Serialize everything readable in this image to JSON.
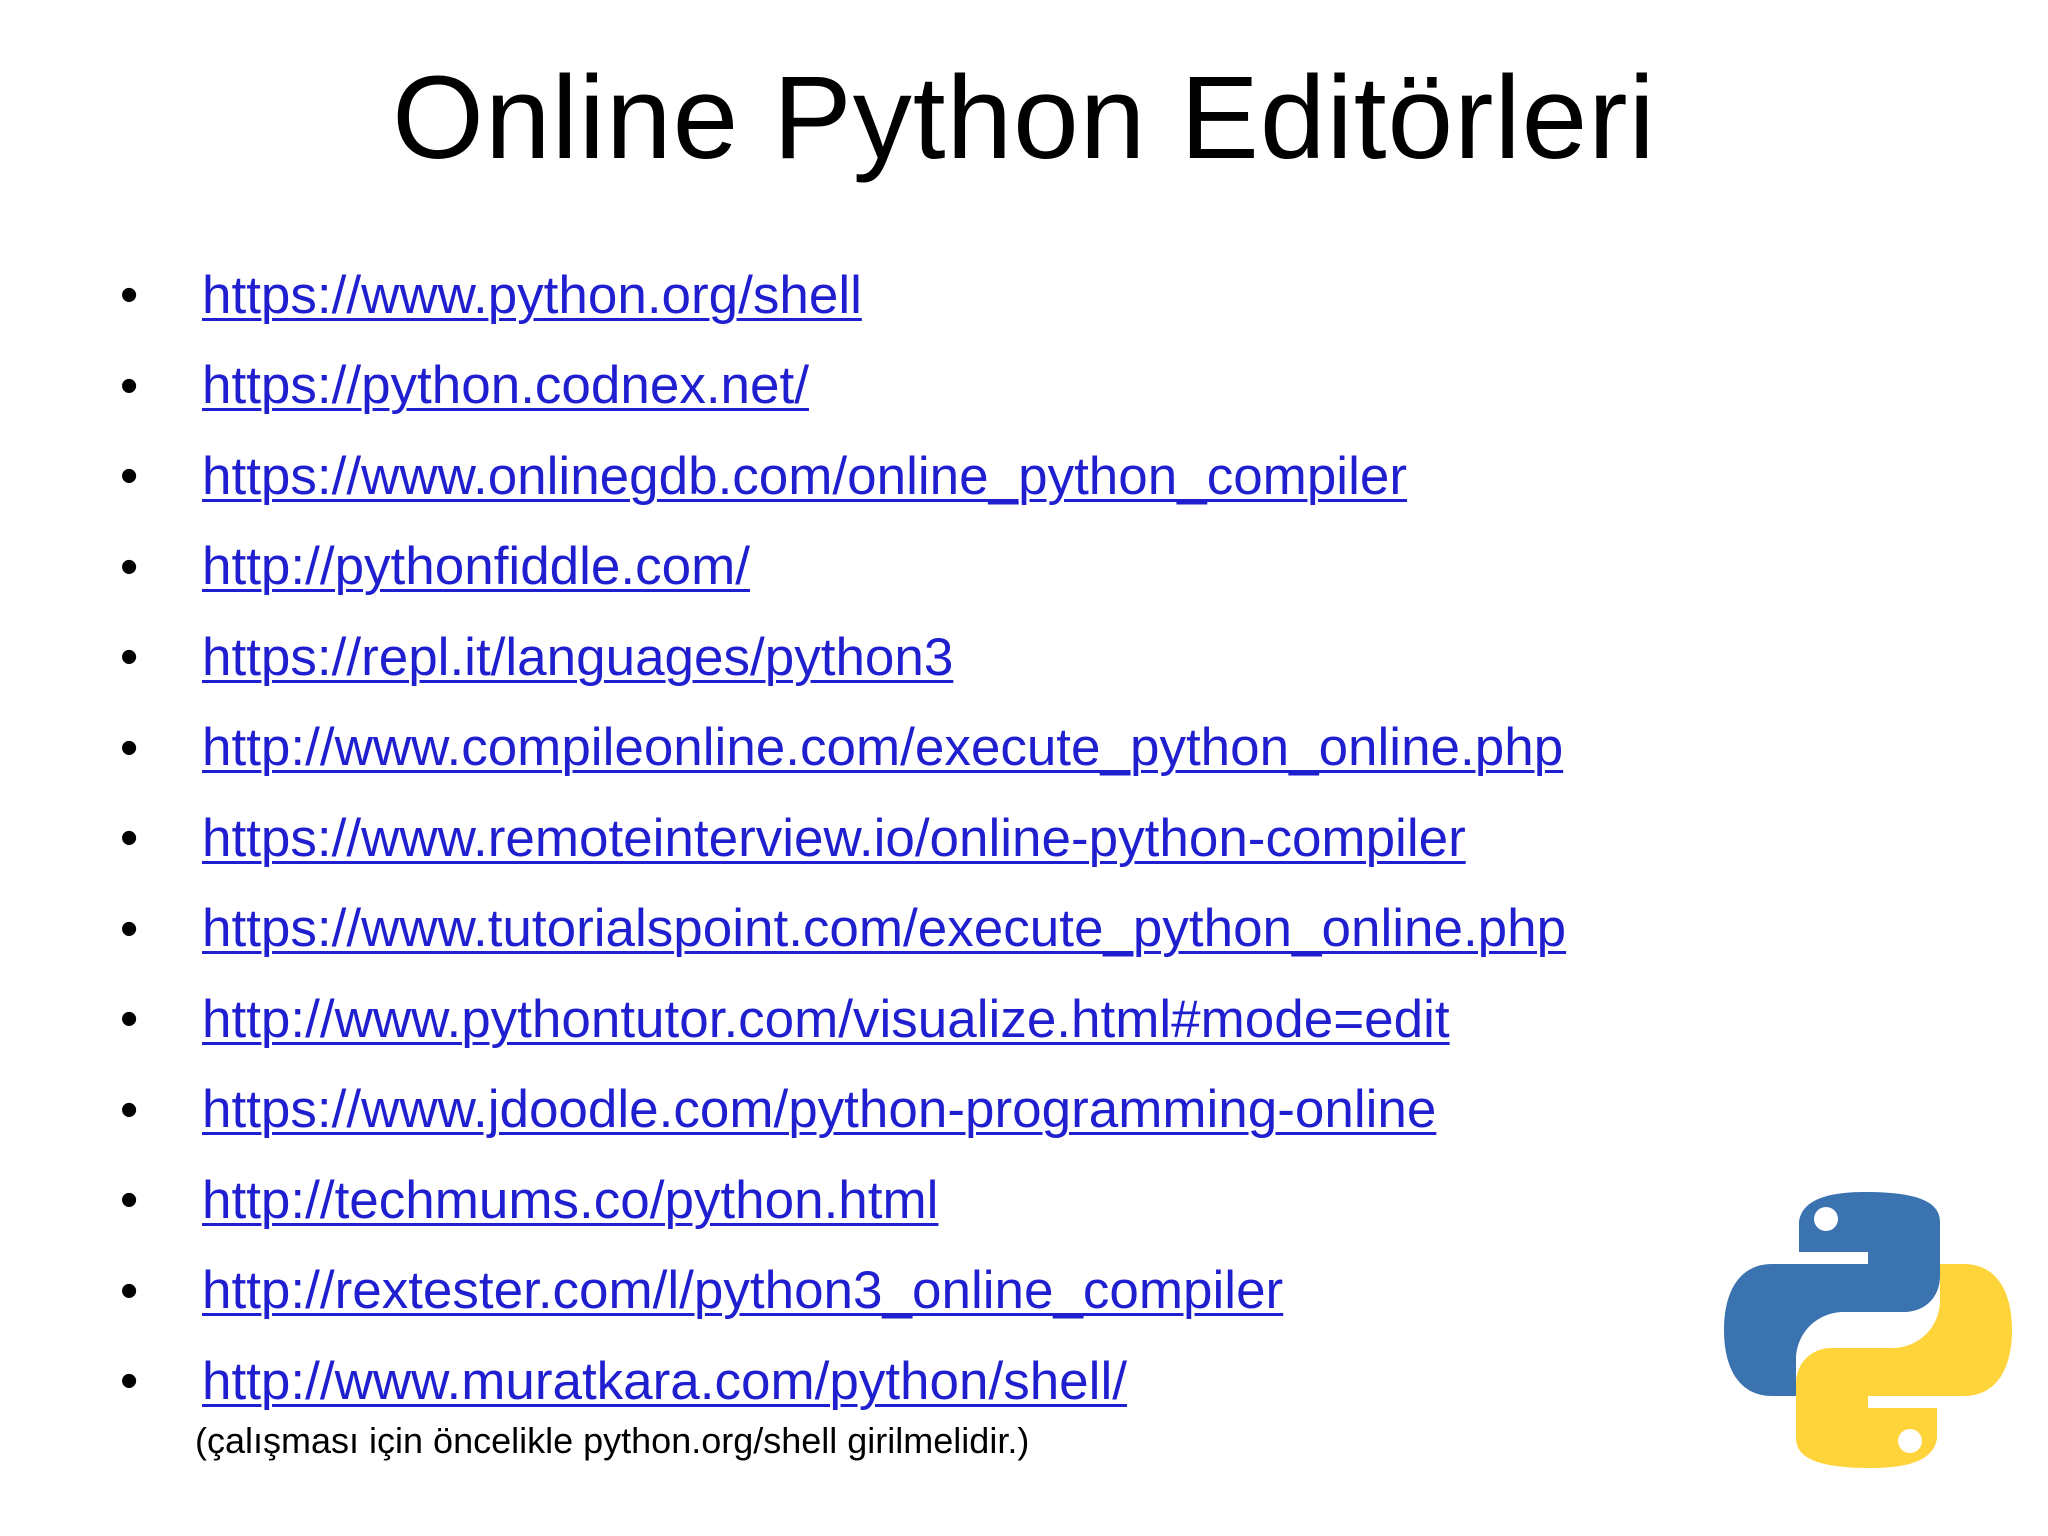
{
  "slide": {
    "title": "Online Python Editörleri",
    "bullet_char": "•",
    "links": [
      "https://www.python.org/shell",
      "https://python.codnex.net/",
      "https://www.onlinegdb.com/online_python_compiler",
      "http://pythonfiddle.com/",
      "https://repl.it/languages/python3",
      "http://www.compileonline.com/execute_python_online.php",
      "https://www.remoteinterview.io/online-python-compiler",
      "https://www.tutorialspoint.com/execute_python_online.php",
      "http://www.pythontutor.com/visualize.html#mode=edit",
      "https://www.jdoodle.com/python-programming-online",
      "http://techmums.co/python.html",
      "http://rextester.com/l/python3_online_compiler",
      "http://www.muratkara.com/python/shell/"
    ],
    "note": "(çalışması için öncelikle python.org/shell girilmelidir.)",
    "logo": {
      "icon": "python-logo-icon",
      "colors": {
        "blue": "#3a73b0",
        "yellow": "#ffd43b"
      }
    },
    "colors": {
      "link": "#1f1fd0",
      "text": "#000000",
      "background": "#ffffff"
    }
  }
}
